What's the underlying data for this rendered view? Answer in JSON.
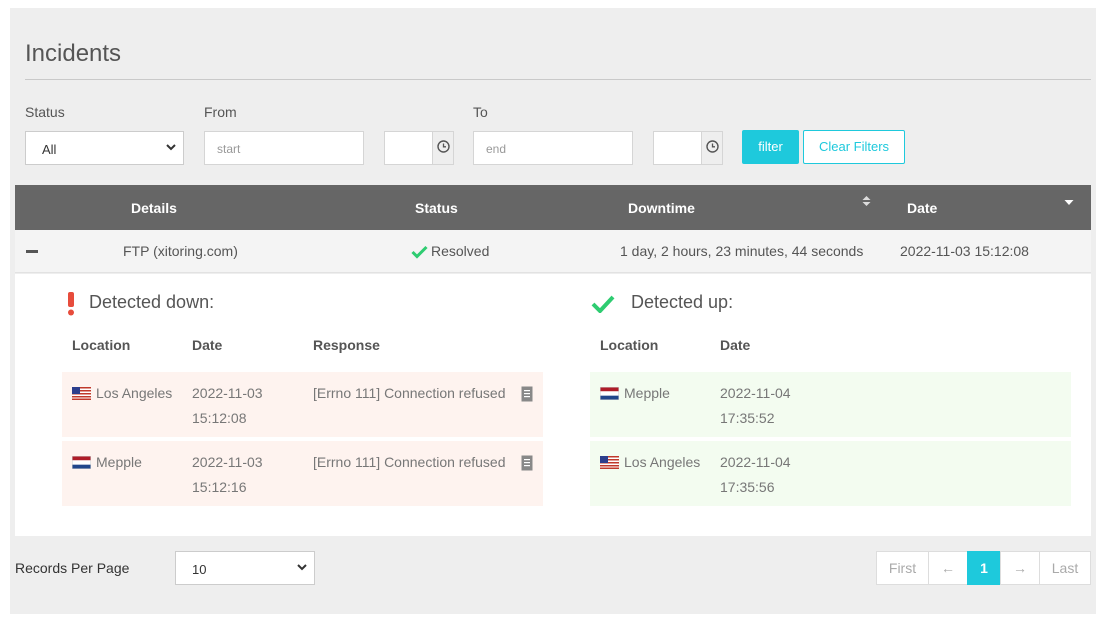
{
  "page": {
    "title": "Incidents"
  },
  "filters": {
    "status_label": "Status",
    "status_value": "All",
    "from_label": "From",
    "from_placeholder": "start",
    "to_label": "To",
    "to_placeholder": "end",
    "filter_button": "filter",
    "clear_button": "Clear Filters"
  },
  "table": {
    "headers": {
      "details": "Details",
      "status": "Status",
      "downtime": "Downtime",
      "date": "Date"
    },
    "row": {
      "details": "FTP (xitoring.com)",
      "status": "Resolved",
      "downtime": "1 day, 2 hours, 23 minutes, 44 seconds",
      "date": "2022-11-03 15:12:08"
    }
  },
  "detail": {
    "down_title": "Detected down:",
    "up_title": "Detected up:",
    "columns": {
      "location": "Location",
      "date": "Date",
      "response": "Response"
    },
    "down_rows": [
      {
        "location": "Los Angeles",
        "flag": "us-flag",
        "date": "2022-11-03",
        "time": "15:12:08",
        "response": "[Errno 111] Connection refused"
      },
      {
        "location": "Mepple",
        "flag": "nl-flag",
        "date": "2022-11-03",
        "time": "15:12:16",
        "response": "[Errno 111] Connection refused"
      }
    ],
    "up_rows": [
      {
        "location": "Mepple",
        "flag": "nl-flag",
        "date": "2022-11-04",
        "time": "17:35:52"
      },
      {
        "location": "Los Angeles",
        "flag": "us-flag",
        "date": "2022-11-04",
        "time": "17:35:56"
      }
    ]
  },
  "footer": {
    "records_label": "Records Per Page",
    "records_value": "10",
    "pagination": {
      "first": "First",
      "prev": "←",
      "current": "1",
      "next": "→",
      "last": "Last"
    }
  },
  "colors": {
    "accent": "#1ec9dc",
    "header_bg": "#666666",
    "down_row": "#fef3ef",
    "up_row": "#f3fcf0",
    "alert": "#e74c3c",
    "success": "#2ecc71"
  }
}
